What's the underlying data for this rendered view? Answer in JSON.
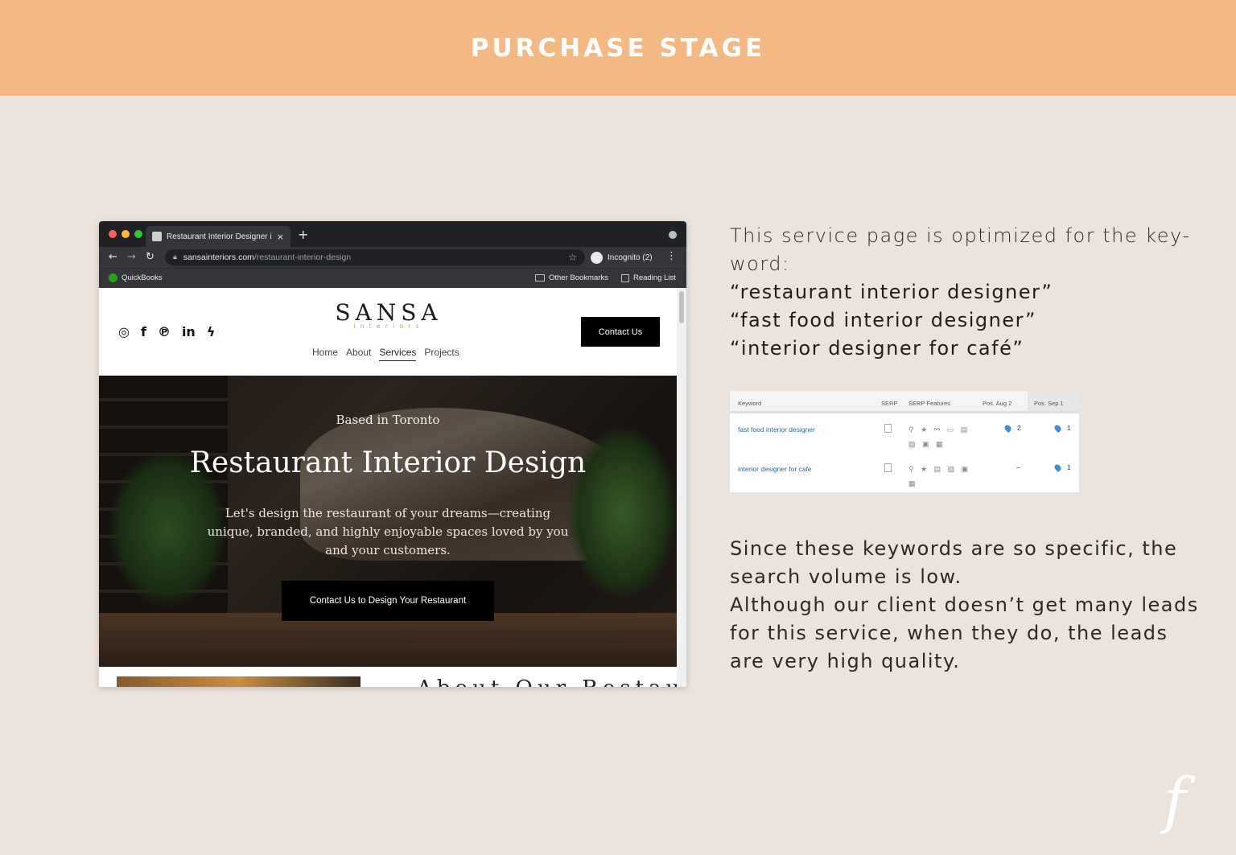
{
  "banner": {
    "title": "PURCHASE STAGE"
  },
  "browser": {
    "tab_title": "Restaurant Interior Designer in",
    "close_glyph": "×",
    "newtab_glyph": "+",
    "url_host": "sansainteriors.com",
    "url_path": "/restaurant-interior-design",
    "incognito_label": "Incognito (2)",
    "bookmarks": {
      "quickbooks": "QuickBooks",
      "other": "Other Bookmarks",
      "reading": "Reading List"
    }
  },
  "site": {
    "logo_main": "SANSA",
    "logo_sub": "interiors",
    "socials": [
      "◎",
      "f",
      "℗",
      "in",
      "ϟ"
    ],
    "nav": [
      "Home",
      "About",
      "Services",
      "Projects"
    ],
    "contact_label": "Contact Us",
    "hero": {
      "kicker": "Based in Toronto",
      "title": "Restaurant Interior Design",
      "description": "Let's design the restaurant of your dreams—creating unique, branded, and highly enjoyable spaces loved by you and your customers.",
      "cta": "Contact Us to Design Your Restaurant"
    },
    "below_heading_cut": "About Our Restaurant"
  },
  "copy": {
    "intro": "This service page is optimized for the key-word:",
    "keywords": [
      "“restaurant interior designer”",
      "“fast food interior designer”",
      "“interior designer for café”"
    ],
    "outro_1": "Since these keywords are so specific, the search volume is low.",
    "outro_2": "Although our client doesn’t get many leads for this service, when they do, the leads are very high quality."
  },
  "table": {
    "headers": [
      "Keyword",
      "SERP",
      "SERP Features",
      "Pos. Aug 2",
      "Pos. Sep 1"
    ],
    "rows": [
      {
        "keyword": "fast food interior designer",
        "features": "⚲ ★ ⚯ ▭ ▤ ▨ ▣ ▦",
        "aug": "2",
        "sep": "1"
      },
      {
        "keyword": "interior designer for cafe",
        "features": "⚲ ★ ▤ ▨ ▣ ▦",
        "aug": "–",
        "sep": "1"
      }
    ]
  },
  "footer_logo": "f",
  "colors": {
    "banner": "#f4b882",
    "background": "#ebe3dc",
    "link": "#2f66b3"
  }
}
